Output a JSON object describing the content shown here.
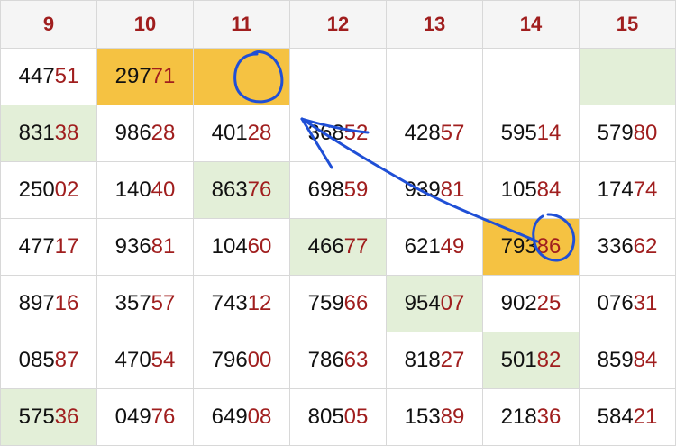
{
  "headers": [
    "9",
    "10",
    "11",
    "12",
    "13",
    "14",
    "15"
  ],
  "rows": [
    [
      {
        "head": "447",
        "tail": "51",
        "bg": "white"
      },
      {
        "head": "297",
        "tail": "71",
        "bg": "orange"
      },
      {
        "head": "",
        "tail": "",
        "bg": "orange"
      },
      {
        "head": "",
        "tail": "",
        "bg": "white"
      },
      {
        "head": "",
        "tail": "",
        "bg": "white"
      },
      {
        "head": "",
        "tail": "",
        "bg": "white"
      },
      {
        "head": "",
        "tail": "",
        "bg": "green"
      }
    ],
    [
      {
        "head": "831",
        "tail": "38",
        "bg": "green"
      },
      {
        "head": "986",
        "tail": "28",
        "bg": "white"
      },
      {
        "head": "401",
        "tail": "28",
        "bg": "white"
      },
      {
        "head": "368",
        "tail": "52",
        "bg": "white"
      },
      {
        "head": "428",
        "tail": "57",
        "bg": "white"
      },
      {
        "head": "595",
        "tail": "14",
        "bg": "white"
      },
      {
        "head": "579",
        "tail": "80",
        "bg": "white"
      }
    ],
    [
      {
        "head": "250",
        "tail": "02",
        "bg": "white"
      },
      {
        "head": "140",
        "tail": "40",
        "bg": "white"
      },
      {
        "head": "863",
        "tail": "76",
        "bg": "green"
      },
      {
        "head": "698",
        "tail": "59",
        "bg": "white"
      },
      {
        "head": "939",
        "tail": "81",
        "bg": "white"
      },
      {
        "head": "105",
        "tail": "84",
        "bg": "white"
      },
      {
        "head": "174",
        "tail": "74",
        "bg": "white"
      }
    ],
    [
      {
        "head": "477",
        "tail": "17",
        "bg": "white"
      },
      {
        "head": "936",
        "tail": "81",
        "bg": "white"
      },
      {
        "head": "104",
        "tail": "60",
        "bg": "white"
      },
      {
        "head": "466",
        "tail": "77",
        "bg": "green"
      },
      {
        "head": "621",
        "tail": "49",
        "bg": "white"
      },
      {
        "head": "793",
        "tail": "86",
        "bg": "orange"
      },
      {
        "head": "336",
        "tail": "62",
        "bg": "white"
      }
    ],
    [
      {
        "head": "897",
        "tail": "16",
        "bg": "white"
      },
      {
        "head": "357",
        "tail": "57",
        "bg": "white"
      },
      {
        "head": "743",
        "tail": "12",
        "bg": "white"
      },
      {
        "head": "759",
        "tail": "66",
        "bg": "white"
      },
      {
        "head": "954",
        "tail": "07",
        "bg": "green"
      },
      {
        "head": "902",
        "tail": "25",
        "bg": "white"
      },
      {
        "head": "076",
        "tail": "31",
        "bg": "white"
      }
    ],
    [
      {
        "head": "085",
        "tail": "87",
        "bg": "white"
      },
      {
        "head": "470",
        "tail": "54",
        "bg": "white"
      },
      {
        "head": "796",
        "tail": "00",
        "bg": "white"
      },
      {
        "head": "786",
        "tail": "63",
        "bg": "white"
      },
      {
        "head": "818",
        "tail": "27",
        "bg": "white"
      },
      {
        "head": "501",
        "tail": "82",
        "bg": "green"
      },
      {
        "head": "859",
        "tail": "84",
        "bg": "white"
      }
    ],
    [
      {
        "head": "575",
        "tail": "36",
        "bg": "green"
      },
      {
        "head": "049",
        "tail": "76",
        "bg": "white"
      },
      {
        "head": "649",
        "tail": "08",
        "bg": "white"
      },
      {
        "head": "805",
        "tail": "05",
        "bg": "white"
      },
      {
        "head": "153",
        "tail": "89",
        "bg": "white"
      },
      {
        "head": "218",
        "tail": "36",
        "bg": "white"
      },
      {
        "head": "584",
        "tail": "21",
        "bg": "white"
      }
    ]
  ],
  "colors": {
    "header_text": "#a01e1e",
    "digit_tail": "#a01e1e",
    "digit_head": "#111111",
    "green_cell": "#e3efd8",
    "orange_cell": "#f5c242",
    "annotation_ink": "#1f4fd6"
  },
  "annotations": {
    "circle_on_empty_cell": "blue-circle-mark",
    "circle_on_79386": "blue-circle-mark",
    "arrow": "blue-arrow-mark"
  }
}
